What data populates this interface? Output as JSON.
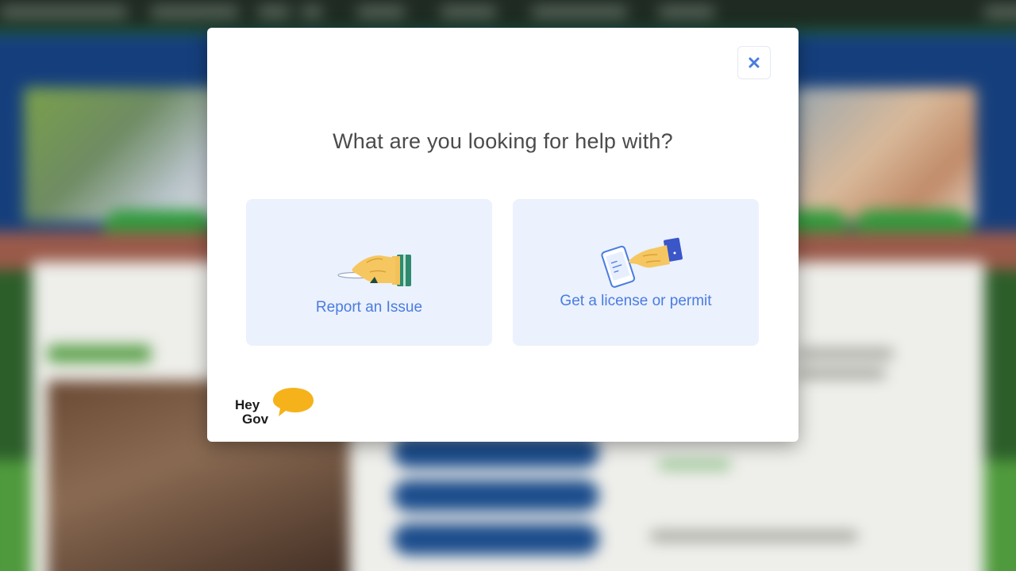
{
  "modal": {
    "title": "What are you looking for help with?",
    "close_icon": "close-icon",
    "options": [
      {
        "label": "Report an Issue",
        "icon": "hand-holding-plate-illustration"
      },
      {
        "label": "Get a license or permit",
        "icon": "hand-tapping-phone-illustration"
      }
    ],
    "logo": {
      "line1": "Hey",
      "line2": "Gov",
      "icon": "speech-bubble-icon"
    }
  },
  "colors": {
    "accent": "#4a7ce0",
    "card_background": "#ebf1fd",
    "title_text": "#4b4b4b",
    "logo_bubble": "#f5b21b",
    "backdrop_blue": "#153f7c"
  }
}
